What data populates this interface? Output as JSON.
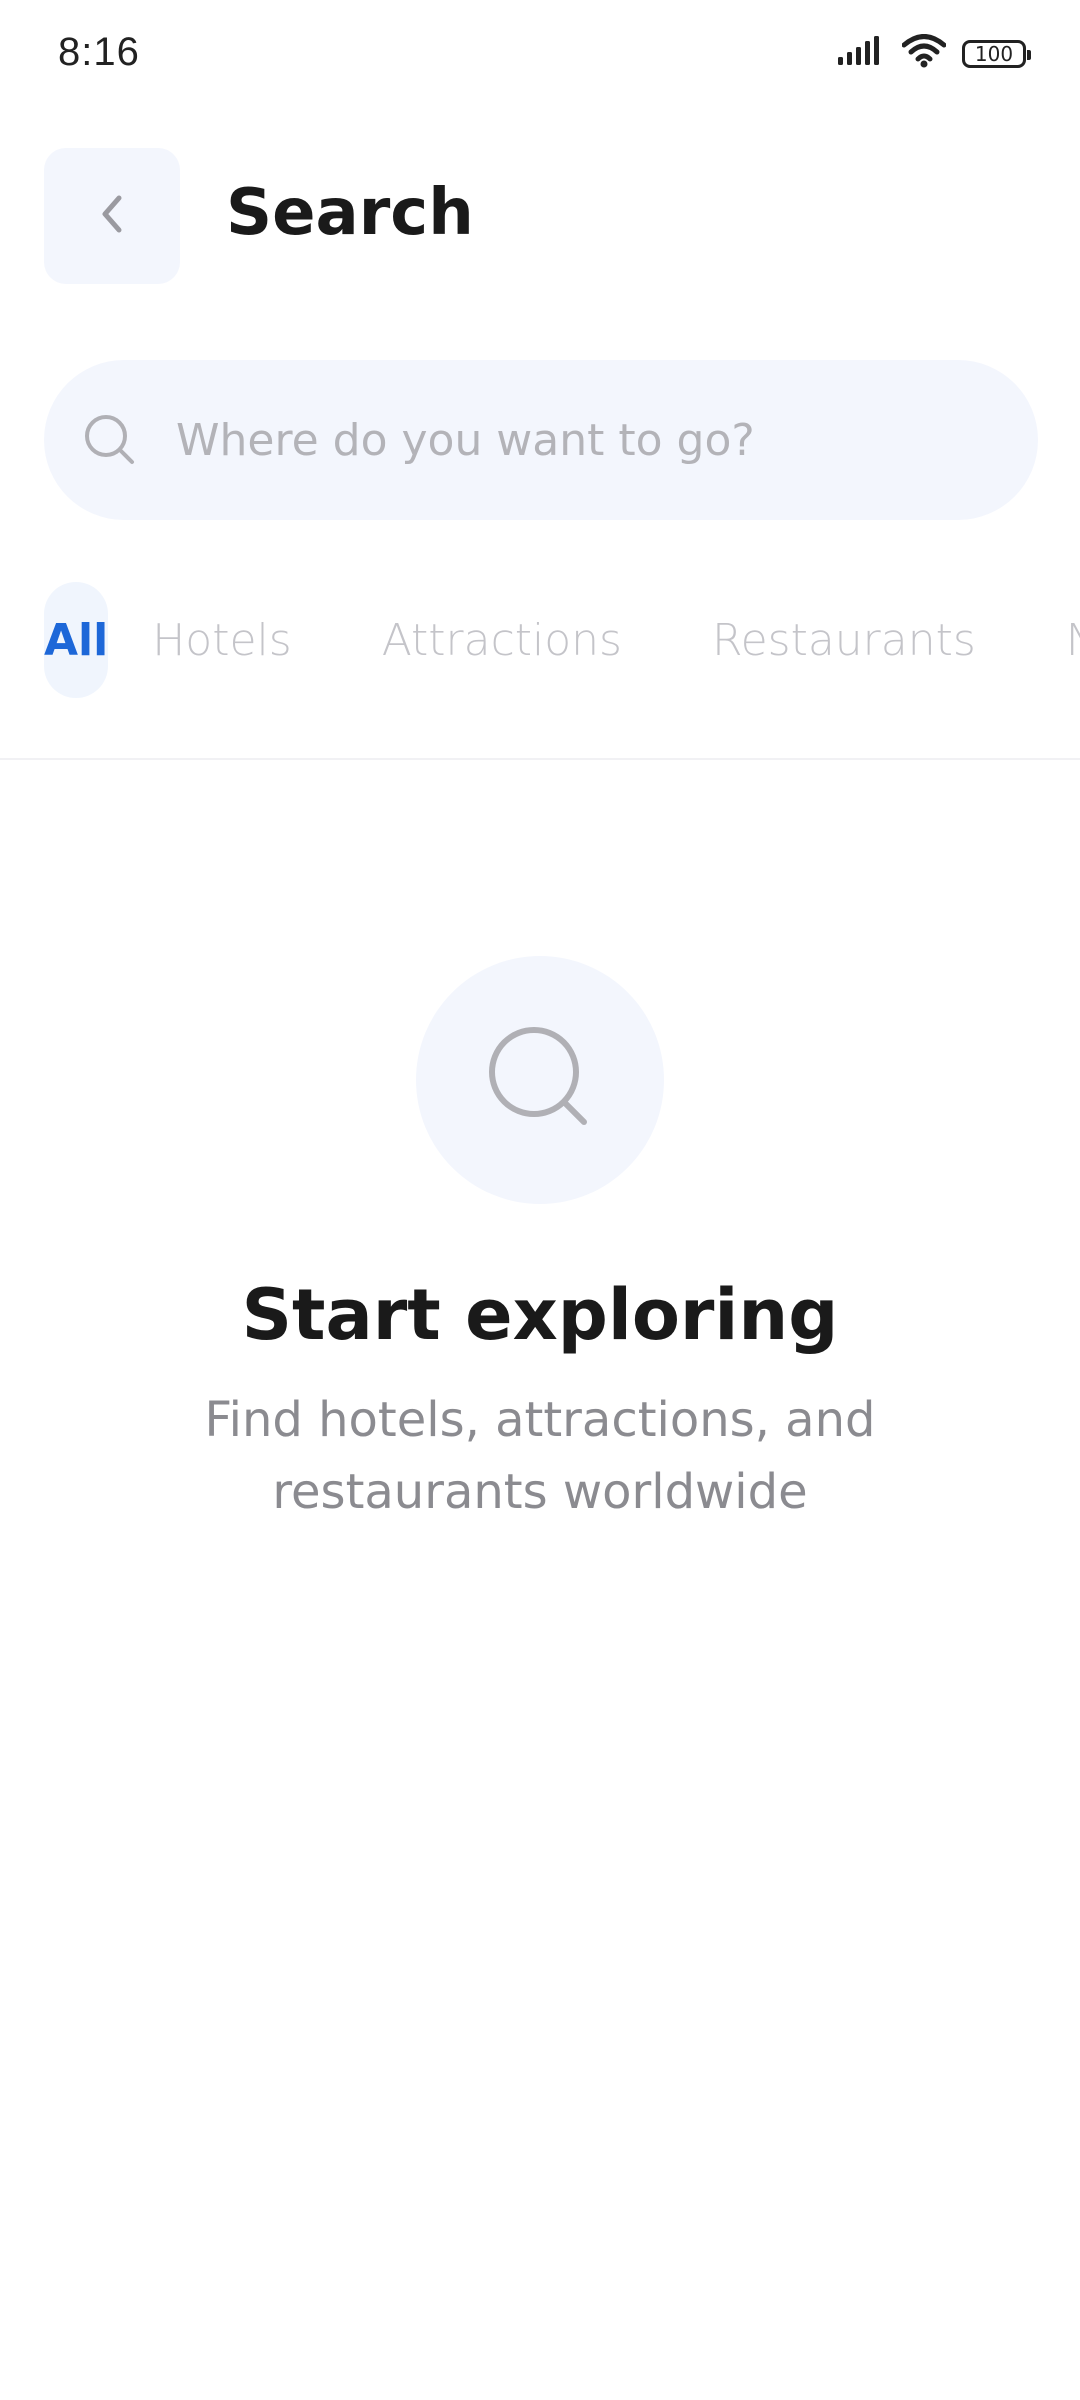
{
  "status_bar": {
    "time": "8:16",
    "battery": "100",
    "icons": [
      "signal-icon",
      "wifi-icon",
      "battery-icon"
    ]
  },
  "header": {
    "back_icon": "chevron-left-icon",
    "title": "Search"
  },
  "search": {
    "icon": "search-icon",
    "placeholder": "Where do you want to go?",
    "value": ""
  },
  "tabs": [
    {
      "label": "All",
      "active": true
    },
    {
      "label": "Hotels",
      "active": false
    },
    {
      "label": "Attractions",
      "active": false
    },
    {
      "label": "Restaurants",
      "active": false
    },
    {
      "label": "N",
      "active": false
    }
  ],
  "empty_state": {
    "icon": "search-icon",
    "title": "Start exploring",
    "subtitle": "Find hotels, attractions, and restaurants worldwide"
  },
  "colors": {
    "accent": "#1d67d8",
    "surface": "#f3f6fd",
    "muted_text": "#8b8b90",
    "inactive_tab": "#c4c4c9"
  }
}
